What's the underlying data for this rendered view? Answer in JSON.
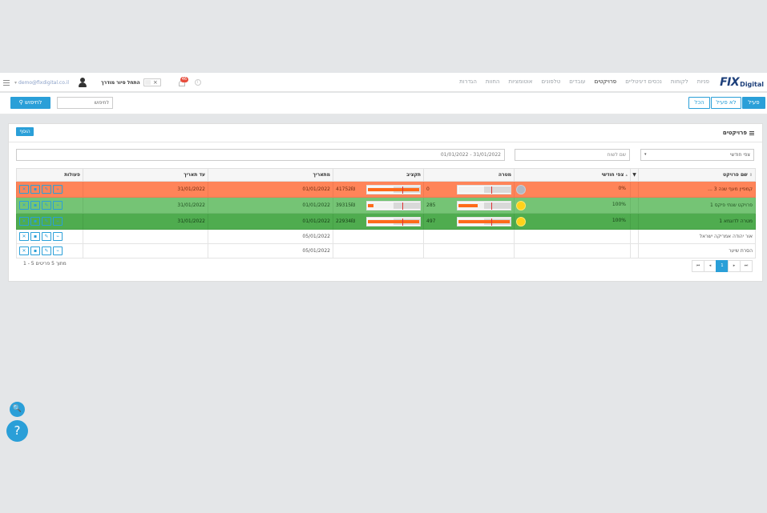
{
  "brand": {
    "logo_main": "FIX",
    "logo_sub": "Digital"
  },
  "nav": {
    "links": [
      "פניות",
      "לקוחות",
      "נכסים דיגיטליים",
      "פרויקטים",
      "עובדים",
      "טלפונים",
      "אוטומציות",
      "החוות",
      "הגדרות"
    ],
    "active_index": 3
  },
  "user": {
    "email": "demo@fixdigital.co.il",
    "caret": "▾"
  },
  "tour": {
    "label": "התחל סיור מודרך",
    "toggle_x": "×"
  },
  "notifications": {
    "count": "46",
    "info": "i"
  },
  "toolbar": {
    "filter_active": "פעיל",
    "filter_inactive": "לא פעיל",
    "filter_all": "הכל",
    "search_placeholder": "לחיפוש",
    "search_button": "לחיפוש"
  },
  "panel": {
    "title": "פרויקטים",
    "add_button": "הוסף",
    "filter_select": "צפי חודשי",
    "filter_caret": "▾",
    "plan_name_placeholder": "שם לשוח",
    "date_range": "01/01/2022 - 31/01/2022"
  },
  "table": {
    "headers": {
      "name": "שם פרויקט",
      "name_sort": "⇕",
      "forecast": "צפי חודשי",
      "forecast_sort": "▴",
      "filter_icon": "▼",
      "goal": "מטרה",
      "budget": "תקציב",
      "from_date": "מתאריך",
      "to_date": "עד תאריך",
      "actions": "פעולות"
    },
    "rows": [
      {
        "name": "קמפיין מעף שנה 3 ...",
        "weather": "cloud",
        "forecast": "0%",
        "goal_value": "0",
        "goal_fill": 0.0,
        "goal_marker": 0.63,
        "budget_value": "41752₪",
        "budget_fill": 0.97,
        "budget_marker": 0.66,
        "from": "01/01/2022",
        "to": "31/01/2022",
        "style": "orange"
      },
      {
        "name": "פרויקט שנתי פיקס 1",
        "weather": "sun",
        "forecast": "100%",
        "goal_value": "285",
        "goal_fill": 0.37,
        "goal_marker": 0.63,
        "budget_value": "39315₪",
        "budget_fill": 0.1,
        "budget_marker": 0.66,
        "from": "01/01/2022",
        "to": "31/01/2022",
        "style": "lgreen"
      },
      {
        "name": "מטרה לדוגמא 1",
        "weather": "sun",
        "forecast": "100%",
        "goal_value": "497",
        "goal_fill": 0.97,
        "goal_marker": 0.63,
        "budget_value": "22934₪",
        "budget_fill": 0.97,
        "budget_marker": 0.66,
        "from": "01/01/2022",
        "to": "31/01/2022",
        "style": "dgreen"
      },
      {
        "name": "אור יהודה אמריקה ישראל",
        "from": "05/01/2022",
        "style": "white"
      },
      {
        "name": "הסרת שיער",
        "from": "05/01/2022",
        "style": "white"
      }
    ],
    "action_icons": [
      "✕",
      "▪",
      "✎",
      "⌁"
    ]
  },
  "pager": {
    "info": "1 - 5 מתוך 5 פריטים",
    "first": "⏮",
    "prev": "◂",
    "current": "1",
    "next": "▸",
    "last": "⏭"
  },
  "floating": {
    "search": "🔍",
    "help": "?"
  }
}
